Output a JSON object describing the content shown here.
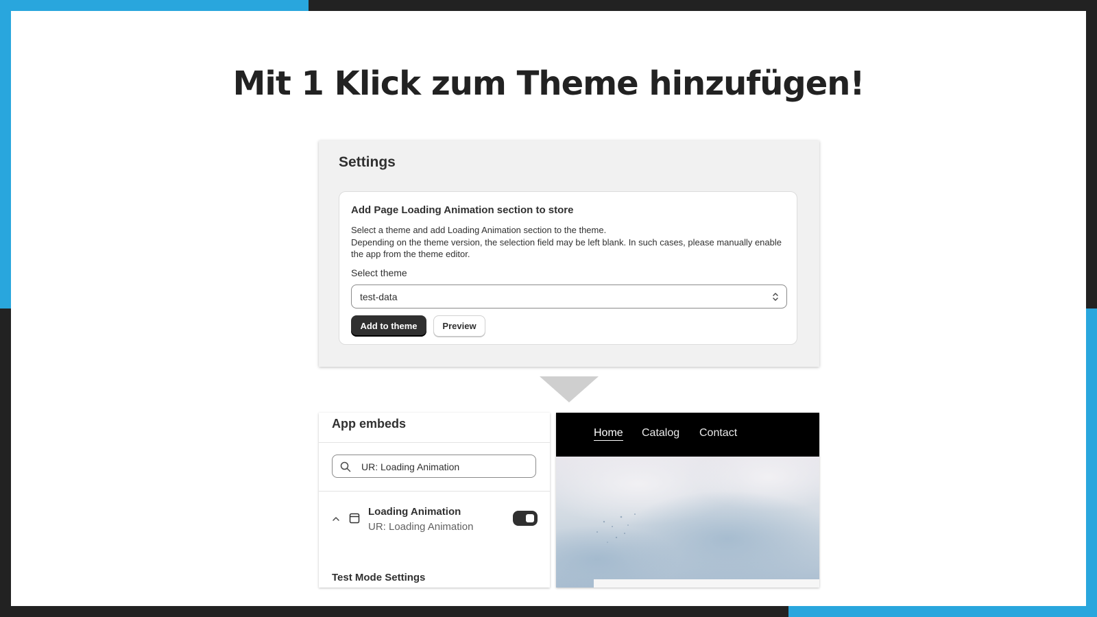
{
  "headline": "Mit 1 Klick zum Theme hinzufügen!",
  "colors": {
    "accent": "#29a6dd",
    "frame": "#222222",
    "primary_button": "#303030"
  },
  "settings": {
    "title": "Settings",
    "card": {
      "title": "Add Page Loading Animation section to store",
      "description_line1": "Select a theme and add Loading Animation section to the theme.",
      "description_line2": "Depending on the theme version, the selection field may be left blank. In such cases, please manually enable the app from the theme editor.",
      "select_label": "Select theme",
      "select_value": "test-data",
      "add_button": "Add to theme",
      "preview_button": "Preview"
    }
  },
  "app_embeds": {
    "title": "App embeds",
    "search_value": "UR: Loading Animation",
    "item": {
      "name": "Loading Animation",
      "subtitle": "UR: Loading Animation",
      "enabled": true
    },
    "section_label": "Test Mode Settings"
  },
  "store_preview": {
    "nav": [
      "Home",
      "Catalog",
      "Contact"
    ],
    "active_nav": "Home"
  }
}
